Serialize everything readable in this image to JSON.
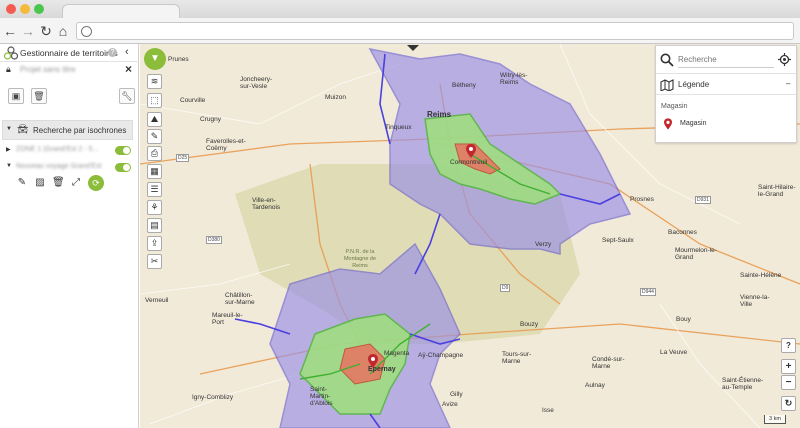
{
  "app": {
    "title": "Gestionnaire de territoires",
    "project_name": "Projet sans titre"
  },
  "layers": {
    "group_label": "Recherche par isochrones",
    "items": [
      {
        "label": "ZONE 1 (Grand'Est 2 - 5...",
        "enabled": true
      },
      {
        "label": "Nouveau voyage Grand'Est",
        "enabled": true
      }
    ]
  },
  "search": {
    "placeholder": "Recherche"
  },
  "legend": {
    "title": "Légende",
    "section": "Magasin",
    "entry_label": "Magasin",
    "marker_color": "#c0282d"
  },
  "map": {
    "scale_label": "3 km",
    "accent_color": "#8bbd3a",
    "zone_colors": {
      "outer": "#9a8fe6",
      "middle": "#9fe07c",
      "inner": "#e87460"
    },
    "places": [
      "Prunes",
      "Joncheery-sur-Vesle",
      "Muizon",
      "Bétheny",
      "Witry-lès-Reims",
      "Courville",
      "Crugny",
      "Tinqueux",
      "Reims",
      "Cormontreuil",
      "Faverolles-et-Coëmy",
      "Ville-en-Tardenois",
      "Prosnes",
      "Baconnes",
      "Saint-Hilaire-le-Grand",
      "Mourmelon-le-Grand",
      "Sept-Saulx",
      "Verzy",
      "Verneuil",
      "Châtillon-sur-Marne",
      "Mareuil-le-Port",
      "Bouzy",
      "Tours-sur-Marne",
      "Aÿ-Champagne",
      "Magenta",
      "Epernay",
      "Saint-Martin-d'Ablois",
      "Igny-Comblizy",
      "Avize",
      "Gilly",
      "Isse",
      "Aulnay",
      "Bouy",
      "Saint-Étienne-au-Temple",
      "La Veuve",
      "Condé-sur-Marne",
      "Vienne-la-Ville",
      "Sainte-Hélène"
    ],
    "park_label": "P.N.R. de la Montagne de Reims"
  }
}
